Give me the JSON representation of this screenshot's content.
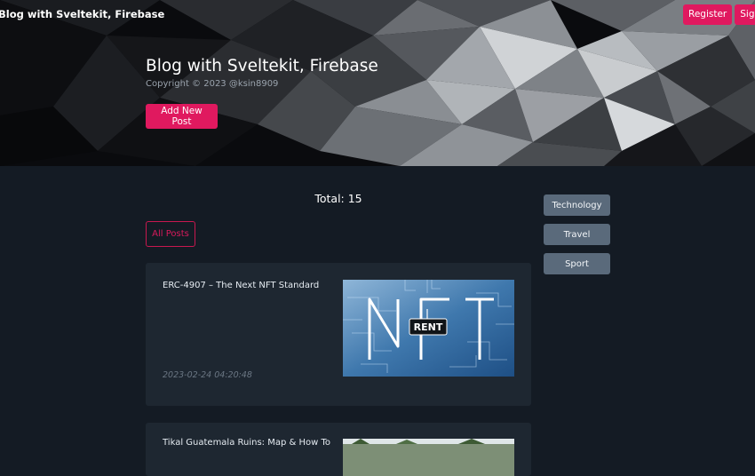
{
  "nav": {
    "brand": "Blog with Sveltekit, Firebase",
    "register_label": "Register",
    "signin_label": "Sign In"
  },
  "hero": {
    "title": "Blog with Sveltekit, Firebase",
    "copyright": "Copyright © 2023 @ksin8909",
    "add_post_label": "Add New Post"
  },
  "main": {
    "total_text": "Total: 15",
    "filter_label": "All Posts",
    "posts": [
      {
        "title": "ERC-4907 – The Next NFT Standard",
        "date": "2023-02-24 04:20:48",
        "thumb_text": "RENT"
      },
      {
        "title": "Tikal Guatemala Ruins: Map & How To Visit"
      }
    ]
  },
  "categories": [
    {
      "label": "Technology"
    },
    {
      "label": "Travel"
    },
    {
      "label": "Sport"
    }
  ],
  "colors": {
    "accent": "#e0195f",
    "page_bg": "#141b24",
    "card_bg": "#1e2731",
    "category_bg": "#5a6a7b"
  }
}
